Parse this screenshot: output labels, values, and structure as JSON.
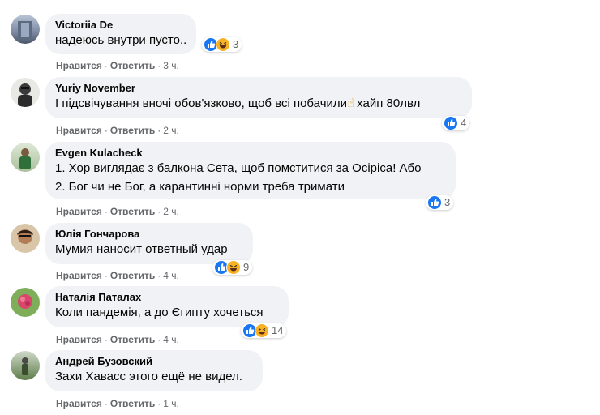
{
  "labels": {
    "like": "Нравится",
    "reply": "Ответить",
    "dot": "·"
  },
  "comments": [
    {
      "author": "Victoriia De",
      "lines": [
        "надеюсь внутри пусто.."
      ],
      "reactions": [
        "like",
        "haha"
      ],
      "count": "3",
      "time": "3 ч."
    },
    {
      "author": "Yuriy November",
      "lines": [
        "І підсвічування вночі обов'язково, щоб всі побачили",
        "хайп 80лвл"
      ],
      "emoji": "☝",
      "reactions": [
        "like"
      ],
      "count": "4",
      "time": "2 ч."
    },
    {
      "author": "Evgen Kulacheck",
      "lines": [
        "1. Хор виглядає з балкона Сета, щоб помститися за Осіріса! Або",
        "2. Бог чи не Бог, а карантинні норми треба тримати"
      ],
      "reactions": [
        "like"
      ],
      "count": "3",
      "time": "2 ч."
    },
    {
      "author": "Юлія Гончарова",
      "lines": [
        "Мумия наносит ответный удар"
      ],
      "reactions": [
        "like",
        "haha"
      ],
      "count": "9",
      "time": "4 ч."
    },
    {
      "author": "Наталія Паталах",
      "lines": [
        "Коли пандемія, а до Єгипту хочеться"
      ],
      "reactions": [
        "like",
        "haha"
      ],
      "count": "14",
      "time": "4 ч."
    },
    {
      "author": "Андрей Бузовский",
      "lines": [
        "Захи Хавасс этого ещё не видел."
      ],
      "reactions": [],
      "count": "",
      "time": "1 ч."
    }
  ],
  "colors": {
    "like": "#1877f2",
    "haha": "#f7b125",
    "bubble": "#f0f2f5",
    "meta": "#65676b"
  }
}
